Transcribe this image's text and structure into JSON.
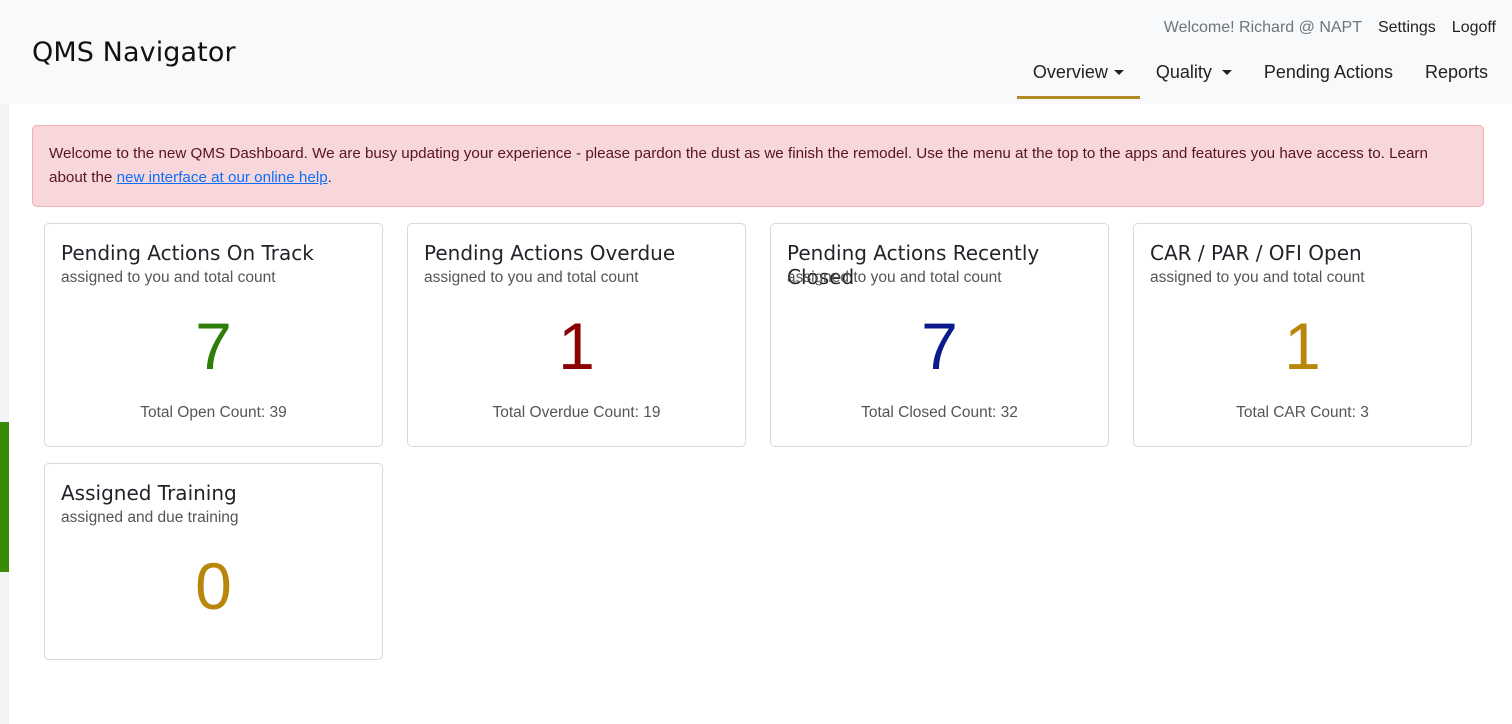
{
  "header": {
    "brand": "QMS Navigator",
    "welcome": "Welcome! Richard @ NAPT",
    "settings": "Settings",
    "logoff": "Logoff",
    "nav": {
      "overview": "Overview",
      "quality": "Quality",
      "pending_actions": "Pending Actions",
      "reports": "Reports"
    }
  },
  "alert": {
    "text_before": "Welcome to the new QMS Dashboard. We are busy updating your experience - please pardon the dust as we finish the remodel. Use the menu at the top to the apps and features you have access to. Learn about the ",
    "link": "new interface at our online help",
    "text_after": "."
  },
  "cards": [
    {
      "title": "Pending Actions On Track",
      "subtitle": "assigned to you and total count",
      "count": "7",
      "total": "Total Open Count: 39",
      "color": "#2e7d0a"
    },
    {
      "title": "Pending Actions Overdue",
      "subtitle": "assigned to you and total count",
      "count": "1",
      "total": "Total Overdue Count: 19",
      "color": "#8b0000"
    },
    {
      "title": "Pending Actions Recently Closed",
      "subtitle": "assigned to you and total count",
      "count": "7",
      "total": "Total Closed Count: 32",
      "color": "#0d1a8c"
    },
    {
      "title": "CAR / PAR / OFI Open",
      "subtitle": "assigned to you and total count",
      "count": "1",
      "total": "Total CAR Count: 3",
      "color": "#b8860b"
    },
    {
      "title": "Assigned Training",
      "subtitle": "assigned and due training",
      "count": "0",
      "color": "#b8860b"
    }
  ]
}
